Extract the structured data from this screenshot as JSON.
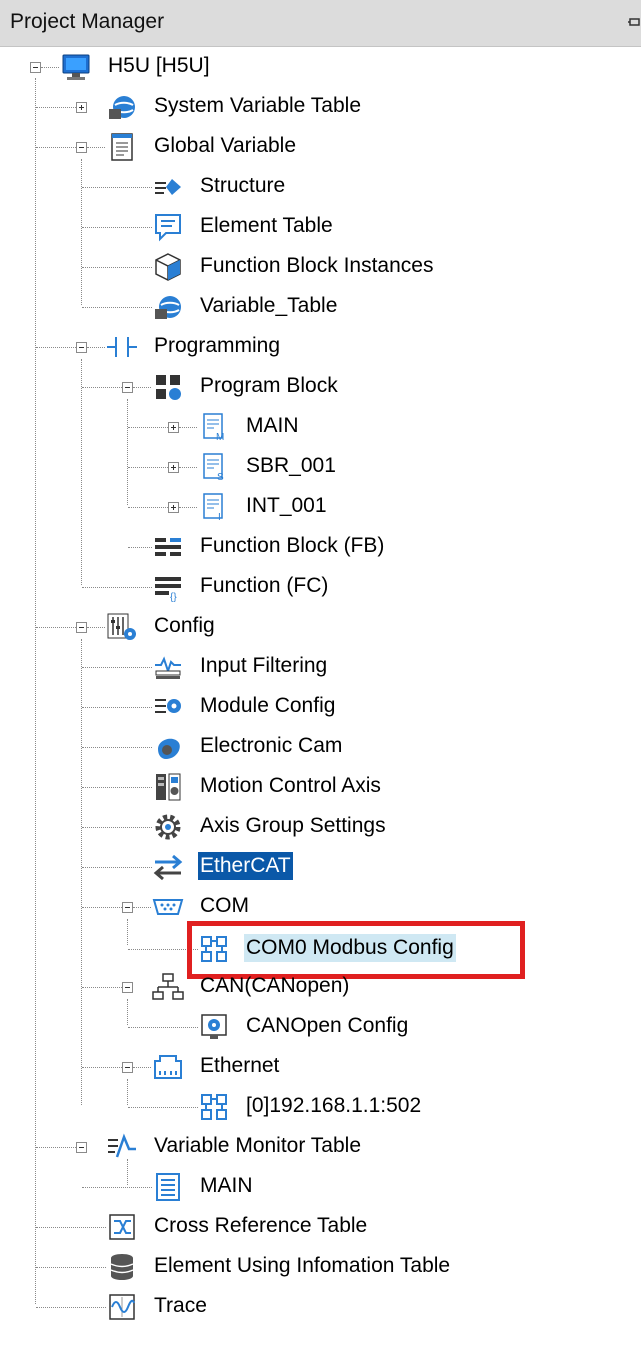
{
  "panel": {
    "title": "Project Manager"
  },
  "tree": {
    "root": "H5U [H5U]",
    "system_variable_table": "System Variable Table",
    "global_variable": "Global Variable",
    "structure": "Structure",
    "element_table": "Element Table",
    "function_block_instances": "Function Block Instances",
    "variable_table": "Variable_Table",
    "programming": "Programming",
    "program_block": "Program Block",
    "main_program": "MAIN",
    "sbr_001": "SBR_001",
    "int_001": "INT_001",
    "function_block_fb": "Function Block (FB)",
    "function_fc": "Function (FC)",
    "config": "Config",
    "input_filtering": "Input Filtering",
    "module_config": "Module Config",
    "electronic_cam": "Electronic Cam",
    "motion_control_axis": "Motion Control Axis",
    "axis_group_settings": "Axis Group Settings",
    "ethercat": "EtherCAT",
    "com": "COM",
    "com0_modbus_config": "COM0 Modbus Config",
    "can": "CAN(CANopen)",
    "canopen_config": "CANOpen Config",
    "ethernet": "Ethernet",
    "ethernet_device": "[0]192.168.1.1:502",
    "variable_monitor_table": "Variable Monitor Table",
    "monitor_main": "MAIN",
    "cross_reference_table": "Cross Reference Table",
    "element_using_information_table": "Element Using Infomation Table",
    "trace": "Trace"
  },
  "colors": {
    "selection": "#0a58a8",
    "hover": "#cfe8f3",
    "highlight_border": "#e02020"
  }
}
